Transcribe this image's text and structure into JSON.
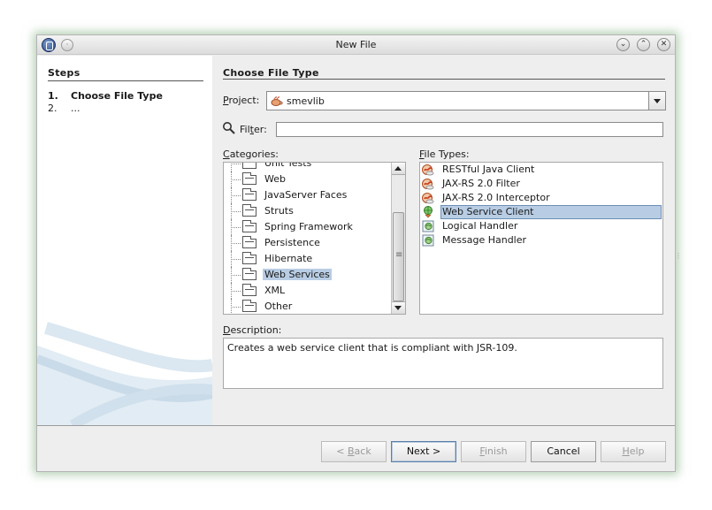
{
  "window": {
    "title": "New File"
  },
  "steps": {
    "title": "Steps",
    "items": [
      {
        "num": "1.",
        "label": "Choose File Type"
      },
      {
        "num": "2.",
        "label": "..."
      }
    ]
  },
  "panel": {
    "title": "Choose File Type"
  },
  "project": {
    "label_u": "P",
    "label_rest": "roject:",
    "value": "smevlib"
  },
  "filter": {
    "label_a": "Fil",
    "label_u": "t",
    "label_b": "er:",
    "value": ""
  },
  "categories": {
    "label_u": "C",
    "label_rest": "ategories:",
    "items": [
      {
        "label": "Unit Tests",
        "selected": false
      },
      {
        "label": "Web",
        "selected": false
      },
      {
        "label": "JavaServer Faces",
        "selected": false
      },
      {
        "label": "Struts",
        "selected": false
      },
      {
        "label": "Spring Framework",
        "selected": false
      },
      {
        "label": "Persistence",
        "selected": false
      },
      {
        "label": "Hibernate",
        "selected": false
      },
      {
        "label": "Web Services",
        "selected": true
      },
      {
        "label": "XML",
        "selected": false
      },
      {
        "label": "Other",
        "selected": false
      }
    ]
  },
  "file_types": {
    "label_u": "F",
    "label_rest": "ile Types:",
    "items": [
      {
        "label": "RESTful Java Client",
        "icon": "java-cup-icon",
        "selected": false
      },
      {
        "label": "JAX-RS 2.0 Filter",
        "icon": "java-cup-icon",
        "selected": false
      },
      {
        "label": "JAX-RS 2.0 Interceptor",
        "icon": "java-cup-icon",
        "selected": false
      },
      {
        "label": "Web Service Client",
        "icon": "web-service-client-icon",
        "selected": true
      },
      {
        "label": "Logical Handler",
        "icon": "handler-icon",
        "selected": false
      },
      {
        "label": "Message Handler",
        "icon": "handler-icon",
        "selected": false
      }
    ]
  },
  "description": {
    "label_u": "D",
    "label_rest": "escription:",
    "text": "Creates a web service client that is compliant with JSR-109."
  },
  "buttons": {
    "back_a": "< ",
    "back_u": "B",
    "back_b": "ack",
    "next": "Next >",
    "finish_u": "F",
    "finish_b": "inish",
    "cancel": "Cancel",
    "help_u": "H",
    "help_b": "elp"
  },
  "colors": {
    "selection": "#b8cde4",
    "window_bg": "#eeeeee",
    "glow": "#78aa78"
  }
}
